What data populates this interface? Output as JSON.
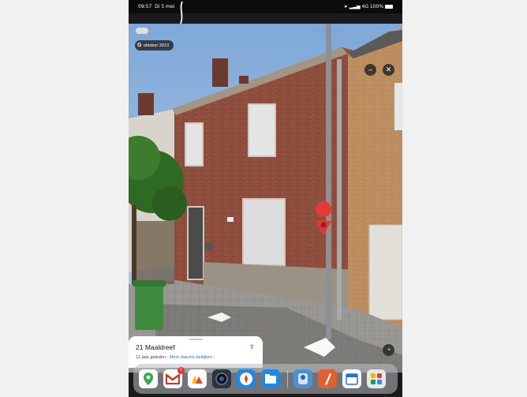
{
  "status_bar": {
    "time": "09:57",
    "date": "Di 5 mei",
    "right": "4G 100%"
  },
  "streetview": {
    "date_label": "oktober 2013",
    "google_badge": "G",
    "minimize_icon": "minus-icon",
    "close_icon": "close-icon",
    "compass_icon": "compass-icon",
    "marker_color": "#e53935"
  },
  "info_card": {
    "address": "21 Maaldreef",
    "age": "12 jaar geleden",
    "separator": "·",
    "more_dates_link": "Meer datums bekijken",
    "share_icon": "share-icon"
  },
  "dock": {
    "apps": [
      {
        "name": "google-maps-app",
        "color": "#ffffff"
      },
      {
        "name": "gmail-app",
        "color": "#ffffff",
        "badge": "1"
      },
      {
        "name": "photos-app",
        "color": "#ffffff"
      },
      {
        "name": "camera-app",
        "color": "#2b3440"
      },
      {
        "name": "safari-app",
        "color": "#1e88e5"
      },
      {
        "name": "files-app",
        "color": "#1e88e5"
      },
      {
        "name": "finder-app",
        "color": "#4a90d9"
      },
      {
        "name": "pen-app",
        "color": "#e06030"
      },
      {
        "name": "calendar-app",
        "color": "#ffffff"
      },
      {
        "name": "app-library",
        "color": "#e8e8e8"
      }
    ]
  }
}
